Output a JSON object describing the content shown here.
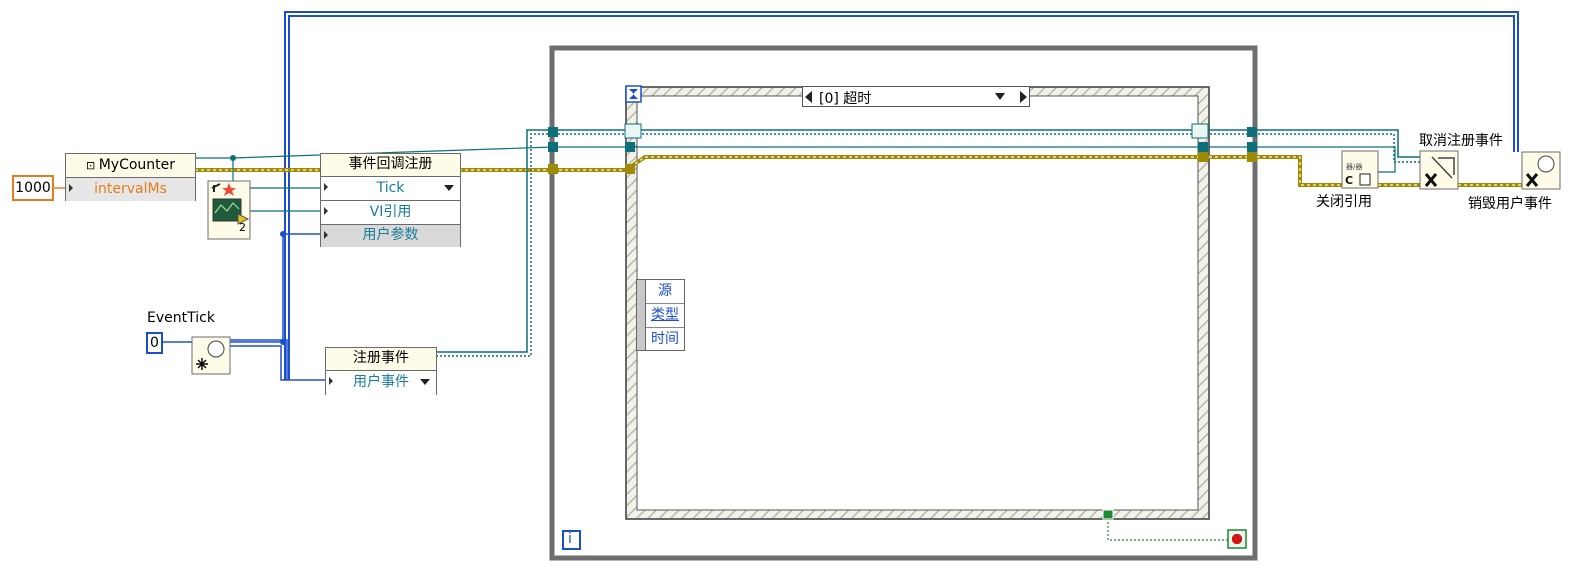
{
  "constants": {
    "interval": "1000",
    "event_tick": "0"
  },
  "labels": {
    "event_tick": "EventTick",
    "close_ref": "关闭引用",
    "unregister": "取消注册事件",
    "destroy": "销毁用户事件"
  },
  "class_node": {
    "name": "MyCounter",
    "property": "intervalMs"
  },
  "callback_node": {
    "title": "事件回调注册",
    "rows": [
      "Tick",
      "VI引用",
      "用户参数"
    ],
    "ref_index": "2"
  },
  "register_node": {
    "title": "注册事件",
    "row": "用户事件"
  },
  "event_structure": {
    "case_label": "[0] 超时",
    "data_nodes": [
      "源",
      "类型",
      "时间"
    ]
  },
  "loop": {
    "iteration": "i"
  },
  "colors": {
    "wire_refnum": "#0d6f7a",
    "wire_blue": "#1b4fcf",
    "wire_class": "#9f8a08",
    "structure_gray": "#6e6e6e",
    "constant_orange": "#e57c1d",
    "stop_red": "#d31515"
  }
}
